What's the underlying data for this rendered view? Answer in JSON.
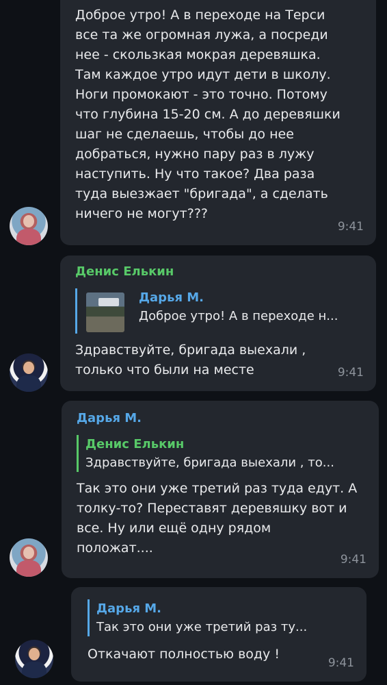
{
  "messages": [
    {
      "text": "Доброе утро! А в переходе на Терси\nвсе та же огромная лужа, а посреди\nнее - скользкая мокрая деревяшка.\nТам каждое утро идут дети в школу.\nНоги промокают - это точно. Потому\nчто глубина 15-20 см. А до деревяшки\nшаг не сделаешь, чтобы до нее\nдобраться, нужно пару раз в лужу\nнаступить.  Ну что такое? Два раза\nтуда выезжает \"бригада\", а сделать\nничего не могут???",
      "time": "9:41"
    },
    {
      "sender": "Денис Елькин",
      "reply_name": "Дарья М.",
      "reply_text": "Доброе утро! А в переходе н...",
      "text": "Здравствуйте, бригада выехали ,\nтолько что были на месте",
      "time": "9:41"
    },
    {
      "sender": "Дарья М.",
      "reply_name": "Денис Елькин",
      "reply_text": "Здравствуйте, бригада выехали , то...",
      "text": "Так это они уже третий раз туда едут. А\nтолку-то? Переставят деревяшку вот и\nвсе. Ну или ещё одну рядом\nположат....",
      "time": "9:41"
    },
    {
      "reply_name": "Дарья М.",
      "reply_text": "Так это они уже третий раз ту...",
      "text": "Откачают полностью воду !",
      "time": "9:41"
    }
  ],
  "colors": {
    "background": "#0e1116",
    "bubble": "#23272e",
    "sender_green": "#58c968",
    "sender_blue": "#56a8e8",
    "time": "#8e949c"
  },
  "icons": [
    "reply-thumbnail-image"
  ]
}
